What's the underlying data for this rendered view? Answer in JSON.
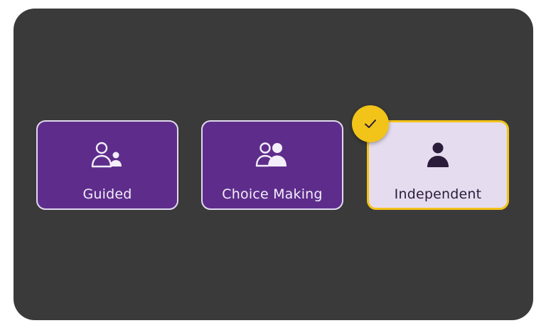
{
  "options": [
    {
      "label": "Guided",
      "icon": "adult-with-child-outline-icon",
      "selected": false
    },
    {
      "label": "Choice Making",
      "icon": "two-people-icon",
      "selected": false
    },
    {
      "label": "Independent",
      "icon": "single-person-icon",
      "selected": true
    }
  ],
  "badge": {
    "icon": "checkmark-icon"
  },
  "colors": {
    "panel": "#3a3a3a",
    "option_unselected_bg": "#5e2d8c",
    "option_unselected_border": "#e2d9ef",
    "option_selected_bg": "#e5ddef",
    "option_selected_border": "#f2c318",
    "badge": "#f2c318",
    "selected_icon": "#2a1c3a"
  }
}
